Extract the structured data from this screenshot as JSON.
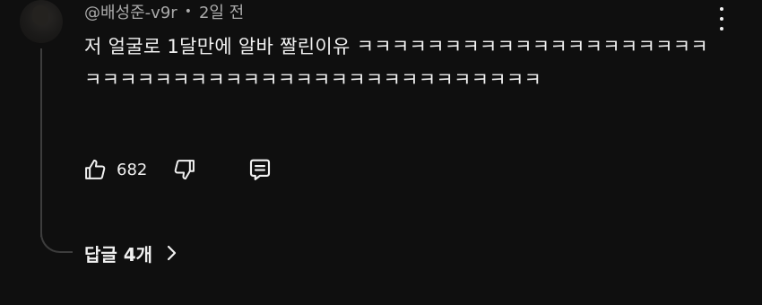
{
  "comment": {
    "author": "@배성준-v9r",
    "separator": "•",
    "time": "2일 전",
    "text": "저 얼굴로 1달만에 알바 짤린이유 ㅋㅋㅋㅋㅋㅋㅋㅋㅋㅋㅋㅋㅋㅋㅋㅋㅋㅋㅋㅋㅋㅋㅋㅋㅋㅋㅋㅋㅋㅋㅋㅋㅋㅋㅋㅋㅋㅋㅋㅋㅋㅋㅋㅋㅋㅋ",
    "like_count": "682",
    "replies_label": "답글 4개"
  },
  "icons": {
    "more": "more-vert-icon",
    "like": "thumbs-up-icon",
    "dislike": "thumbs-down-icon",
    "reply": "comment-reply-icon",
    "chevron": "chevron-right-icon"
  },
  "colors": {
    "background": "#0f0f0f",
    "text": "#f1f1f1",
    "meta": "#aaaaaa",
    "thread": "#3d3d3d"
  }
}
